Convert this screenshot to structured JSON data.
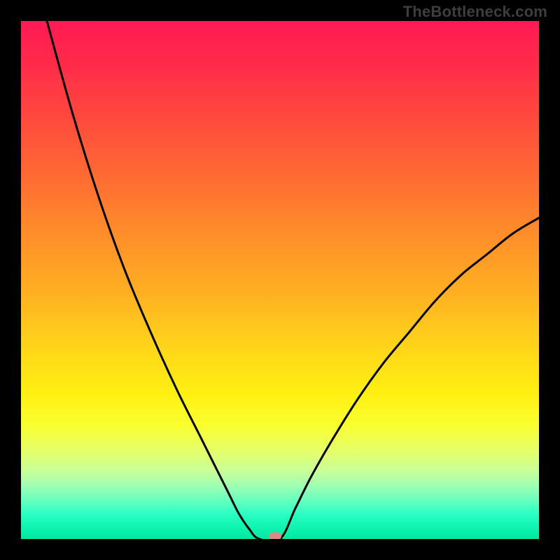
{
  "watermark": "TheBottleneck.com",
  "colors": {
    "background": "#000000",
    "curve": "#000000",
    "marker": "#d98b84",
    "gradient_stops": [
      {
        "pos": 0.0,
        "hex": "#ff1a53"
      },
      {
        "pos": 0.08,
        "hex": "#ff2a4a"
      },
      {
        "pos": 0.18,
        "hex": "#ff473d"
      },
      {
        "pos": 0.3,
        "hex": "#ff6b33"
      },
      {
        "pos": 0.4,
        "hex": "#ff8a2a"
      },
      {
        "pos": 0.52,
        "hex": "#ffae22"
      },
      {
        "pos": 0.62,
        "hex": "#ffd21a"
      },
      {
        "pos": 0.72,
        "hex": "#fff012"
      },
      {
        "pos": 0.78,
        "hex": "#f9ff2f"
      },
      {
        "pos": 0.83,
        "hex": "#e6ff6a"
      },
      {
        "pos": 0.87,
        "hex": "#c8ff9a"
      },
      {
        "pos": 0.9,
        "hex": "#9affb4"
      },
      {
        "pos": 0.93,
        "hex": "#5cffc0"
      },
      {
        "pos": 0.95,
        "hex": "#2effc4"
      },
      {
        "pos": 0.97,
        "hex": "#16f7b6"
      },
      {
        "pos": 1.0,
        "hex": "#00e8a0"
      }
    ]
  },
  "chart_data": {
    "type": "line",
    "title": "",
    "xlabel": "",
    "ylabel": "",
    "xlim": [
      0,
      100
    ],
    "ylim": [
      0,
      100
    ],
    "grid": false,
    "description": "Black V-shaped curve on vertical red→green gradient. Left branch descends steeply from top-left, flattens to a short floor segment; right branch rises with decreasing slope toward mid-right. A small rounded marker sits at the valley minimum.",
    "series": [
      {
        "name": "left_branch",
        "x": [
          5,
          10,
          15,
          20,
          25,
          30,
          35,
          40,
          42,
          44,
          46
        ],
        "y": [
          100,
          82,
          66,
          52,
          40,
          29,
          19,
          9,
          5,
          2,
          0
        ]
      },
      {
        "name": "valley_floor",
        "x": [
          46,
          50
        ],
        "y": [
          0,
          0
        ]
      },
      {
        "name": "right_branch",
        "x": [
          50,
          53,
          56,
          60,
          65,
          70,
          75,
          80,
          85,
          90,
          95,
          100
        ],
        "y": [
          0,
          6,
          12,
          19,
          27,
          34,
          40,
          46,
          51,
          55,
          59,
          62
        ]
      }
    ],
    "marker": {
      "x": 49,
      "y": 0.5
    }
  }
}
